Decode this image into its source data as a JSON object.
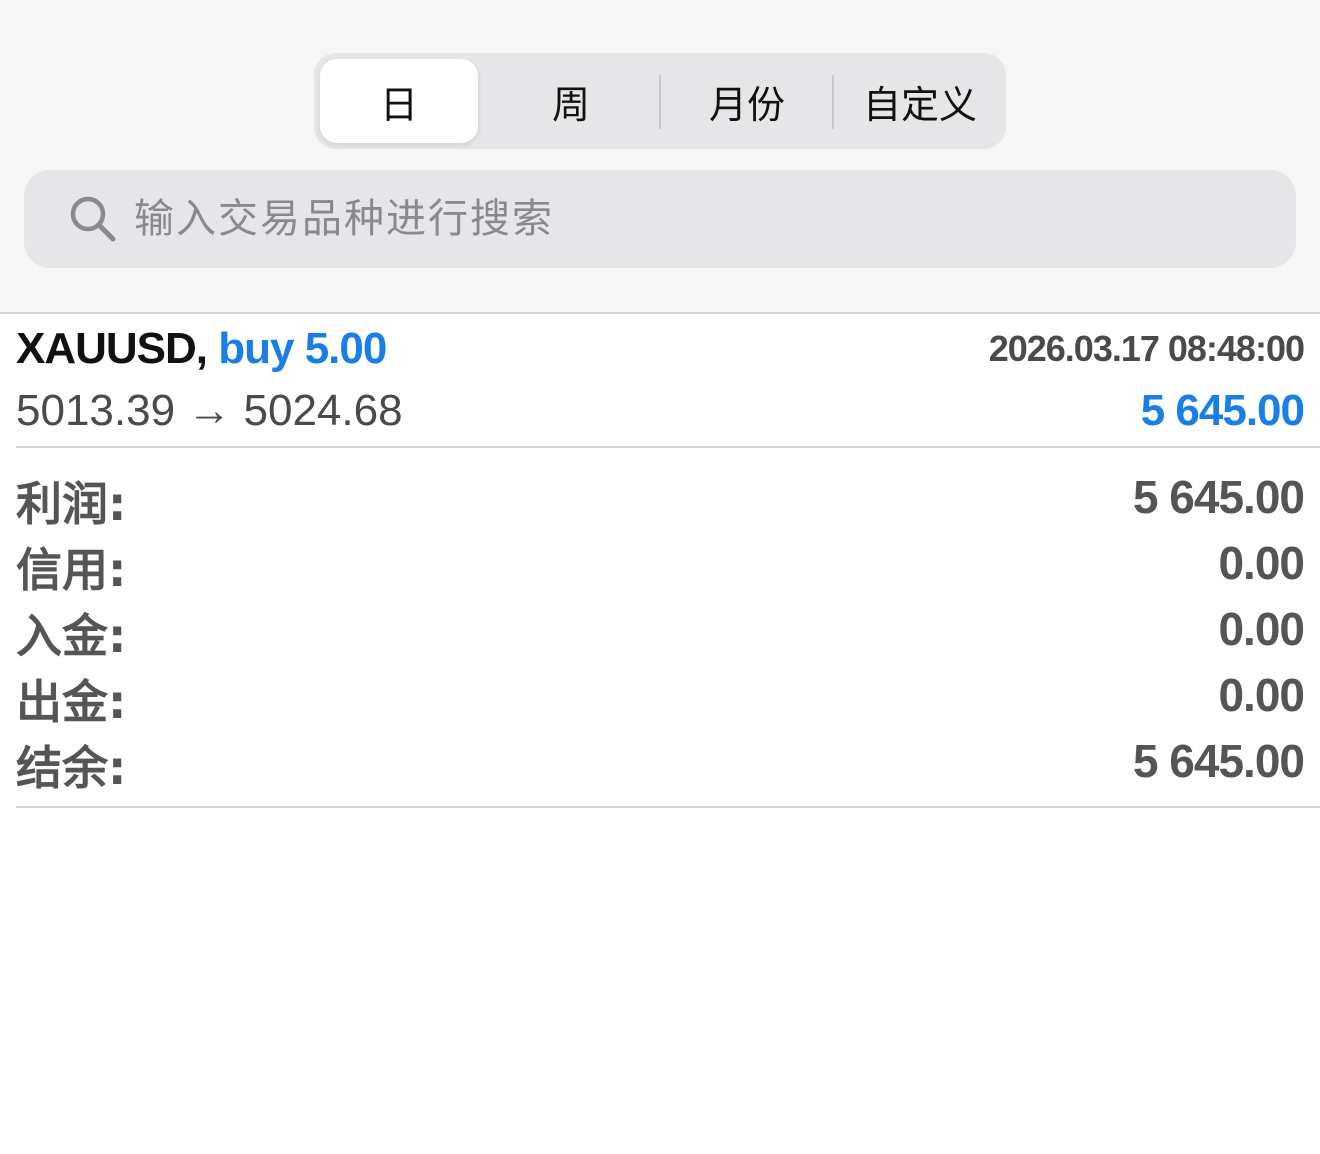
{
  "period_tabs": {
    "items": [
      {
        "label": "日",
        "active": true
      },
      {
        "label": "周",
        "active": false
      },
      {
        "label": "月份",
        "active": false
      },
      {
        "label": "自定义",
        "active": false
      }
    ]
  },
  "search": {
    "placeholder": "输入交易品种进行搜索",
    "value": ""
  },
  "deal": {
    "symbol": "XAUUSD,",
    "side": "buy 5.00",
    "time": "2026.03.17 08:48:00",
    "prices": "5013.39 → 5024.68",
    "profit": "5 645.00"
  },
  "summary": {
    "rows": [
      {
        "label": "利润:",
        "value": "5 645.00"
      },
      {
        "label": "信用:",
        "value": "0.00"
      },
      {
        "label": "入金:",
        "value": "0.00"
      },
      {
        "label": "出金:",
        "value": "0.00"
      },
      {
        "label": "结余:",
        "value": "5 645.00"
      }
    ]
  },
  "colors": {
    "accent": "#1a7ee8",
    "text_primary": "#111111",
    "text_secondary": "#555555",
    "header_bg": "#f6f6f7",
    "control_bg": "#e6e6e9"
  },
  "icons": {
    "search": "search-icon"
  }
}
